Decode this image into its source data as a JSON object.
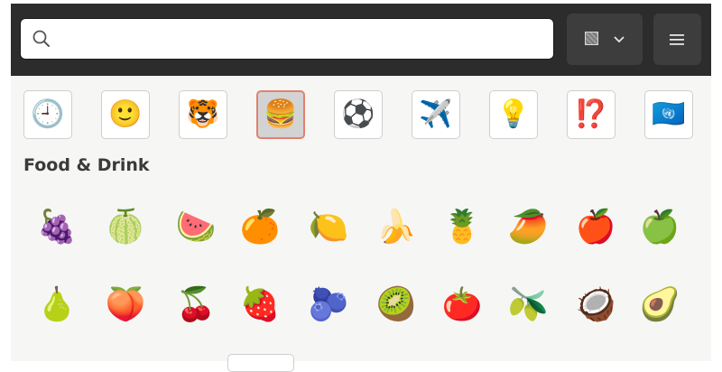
{
  "search": {
    "value": "",
    "placeholder": ""
  },
  "icons": {
    "search": "search-icon",
    "variant_swatch": "skin-tone-swatch-icon",
    "chevron": "chevron-down-icon",
    "menu": "hamburger-menu-icon"
  },
  "categories": [
    {
      "name": "recent",
      "glyph": "🕘",
      "selected": false
    },
    {
      "name": "smileys",
      "glyph": "🙂",
      "selected": false
    },
    {
      "name": "animals",
      "glyph": "🐯",
      "selected": false
    },
    {
      "name": "food-drink",
      "glyph": "🍔",
      "selected": true
    },
    {
      "name": "activities",
      "glyph": "⚽",
      "selected": false
    },
    {
      "name": "travel",
      "glyph": "✈️",
      "selected": false
    },
    {
      "name": "objects",
      "glyph": "💡",
      "selected": false
    },
    {
      "name": "symbols",
      "glyph": "⁉️",
      "selected": false
    },
    {
      "name": "flags",
      "glyph": "🇺🇳",
      "selected": false
    }
  ],
  "section": {
    "title": "Food & Drink"
  },
  "emoji_rows": [
    [
      {
        "name": "grapes",
        "glyph": "🍇"
      },
      {
        "name": "melon",
        "glyph": "🍈"
      },
      {
        "name": "watermelon",
        "glyph": "🍉"
      },
      {
        "name": "tangerine",
        "glyph": "🍊"
      },
      {
        "name": "lemon",
        "glyph": "🍋"
      },
      {
        "name": "banana",
        "glyph": "🍌"
      },
      {
        "name": "pineapple",
        "glyph": "🍍"
      },
      {
        "name": "mango",
        "glyph": "🥭"
      },
      {
        "name": "red-apple",
        "glyph": "🍎"
      },
      {
        "name": "green-apple",
        "glyph": "🍏"
      }
    ],
    [
      {
        "name": "pear",
        "glyph": "🍐"
      },
      {
        "name": "peach",
        "glyph": "🍑"
      },
      {
        "name": "cherries",
        "glyph": "🍒"
      },
      {
        "name": "strawberry",
        "glyph": "🍓"
      },
      {
        "name": "blueberries",
        "glyph": "🫐"
      },
      {
        "name": "kiwi",
        "glyph": "🥝"
      },
      {
        "name": "tomato",
        "glyph": "🍅"
      },
      {
        "name": "olive",
        "glyph": "🫒"
      },
      {
        "name": "coconut",
        "glyph": "🥥"
      },
      {
        "name": "avocado",
        "glyph": "🥑"
      }
    ]
  ],
  "colors": {
    "header_bg": "#2c2c2c",
    "button_bg": "#3d3d3d",
    "selected_border": "#e0826e",
    "panel_bg": "#f6f6f5"
  }
}
